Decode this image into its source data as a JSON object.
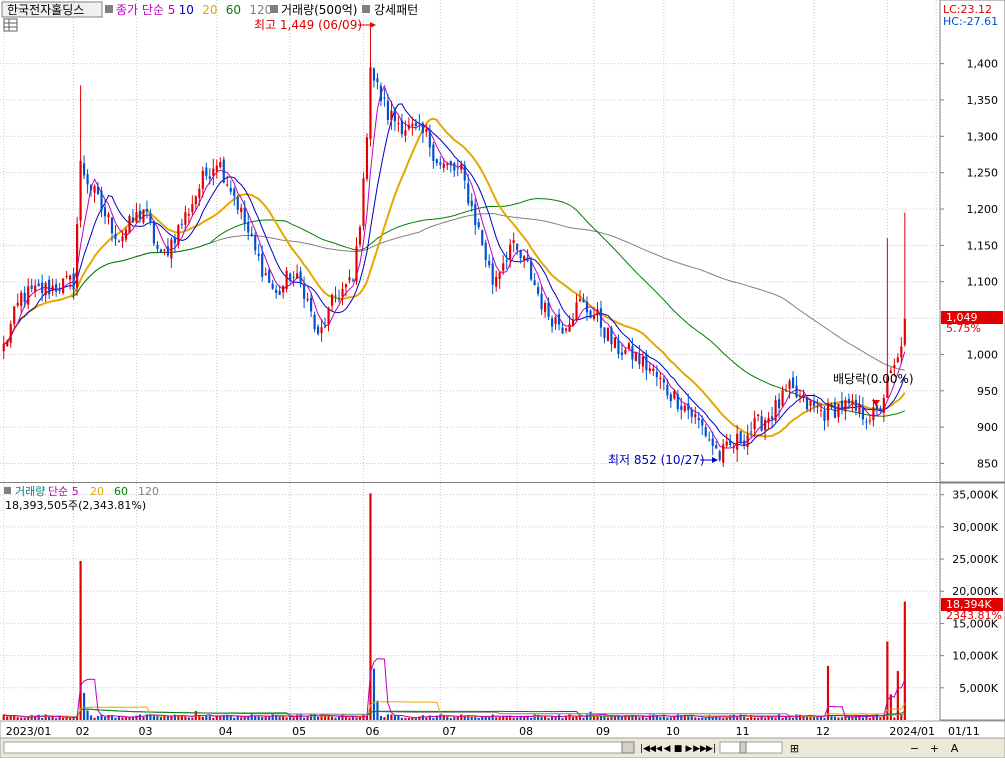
{
  "header": {
    "stock_name": "한국전자홀딩스",
    "price_ma_legend": [
      {
        "label": "종가 단순 5",
        "color": "#c000c0"
      },
      {
        "label": "10",
        "color": "#0000c0"
      },
      {
        "label": "20",
        "color": "#e6a800"
      },
      {
        "label": "60",
        "color": "#008000"
      },
      {
        "label": "120",
        "color": "#808080"
      }
    ],
    "volume_amount_label": "거래량(500억)",
    "pattern_label": "강세패턴",
    "lc_label": "LC:23.12",
    "hc_label": "HC:-27.61"
  },
  "price_panel": {
    "y_ticks": [
      {
        "value": 850,
        "label": "850"
      },
      {
        "value": 900,
        "label": "900"
      },
      {
        "value": 950,
        "label": "950"
      },
      {
        "value": 1000,
        "label": "1,000"
      },
      {
        "value": 1050,
        "label": "1,050"
      },
      {
        "value": 1100,
        "label": "1,100"
      },
      {
        "value": 1150,
        "label": "1,150"
      },
      {
        "value": 1200,
        "label": "1,200"
      },
      {
        "value": 1250,
        "label": "1,250"
      },
      {
        "value": 1300,
        "label": "1,300"
      },
      {
        "value": 1350,
        "label": "1,350"
      },
      {
        "value": 1400,
        "label": "1,400"
      }
    ],
    "current_price_label": "1,049",
    "current_change_label": "5.75%",
    "high_annotation": "최고 1,449 (06/09)",
    "low_annotation": "최저 852 (10/27)",
    "dividend_annotation": "배당락(0.00%)"
  },
  "volume_panel": {
    "legend": [
      {
        "label": "거래량",
        "color": "#008080"
      },
      {
        "label": "단순 5",
        "color": "#c000c0"
      },
      {
        "label": "20",
        "color": "#e6a800"
      },
      {
        "label": "60",
        "color": "#008000"
      },
      {
        "label": "120",
        "color": "#808080"
      }
    ],
    "current_volume_text": "18,393,505주(2,343.81%)",
    "y_ticks": [
      {
        "value": 5000,
        "label": "5,000K"
      },
      {
        "value": 10000,
        "label": "10,000K"
      },
      {
        "value": 15000,
        "label": "15,000K"
      },
      {
        "value": 20000,
        "label": "20,000K"
      },
      {
        "value": 25000,
        "label": "25,000K"
      },
      {
        "value": 30000,
        "label": "30,000K"
      },
      {
        "value": 35000,
        "label": "35,000K"
      }
    ],
    "current_volume_label": "18,394K",
    "current_volume_pct_label": "2343.81%"
  },
  "x_axis": {
    "labels": [
      {
        "text": "2023/01",
        "pos": 0
      },
      {
        "text": "02",
        "pos": 20
      },
      {
        "text": "03",
        "pos": 38
      },
      {
        "text": "04",
        "pos": 61
      },
      {
        "text": "05",
        "pos": 82
      },
      {
        "text": "06",
        "pos": 103
      },
      {
        "text": "07",
        "pos": 125
      },
      {
        "text": "08",
        "pos": 147
      },
      {
        "text": "09",
        "pos": 169
      },
      {
        "text": "10",
        "pos": 189
      },
      {
        "text": "11",
        "pos": 209
      },
      {
        "text": "12",
        "pos": 232
      },
      {
        "text": "2024/01",
        "pos": 253
      },
      {
        "text": "01/11",
        "pos": 267
      }
    ]
  },
  "nav_buttons": [
    {
      "name": "first-button",
      "glyph": "|◀"
    },
    {
      "name": "prev-fast-button",
      "glyph": "◀◀"
    },
    {
      "name": "prev-button",
      "glyph": "◀"
    },
    {
      "name": "stop-button",
      "glyph": "■"
    },
    {
      "name": "next-button",
      "glyph": "▶"
    },
    {
      "name": "next-fast-button",
      "glyph": "▶▶"
    },
    {
      "name": "last-button",
      "glyph": "▶|"
    }
  ],
  "zoom_buttons": [
    {
      "name": "zoom-reset-button",
      "glyph": "⊞"
    },
    {
      "name": "zoom-out-button",
      "glyph": "−"
    },
    {
      "name": "zoom-in-button",
      "glyph": "+"
    },
    {
      "name": "auto-button",
      "glyph": "A"
    }
  ],
  "colors": {
    "up": "#e00000",
    "down": "#0050d0",
    "ma5": "#c000c0",
    "ma10": "#0000c0",
    "ma20": "#e6a800",
    "ma60": "#008000",
    "ma120": "#808080",
    "grid": "#c8c8c8",
    "axis_bg": "#ffffff",
    "current_tag": "#e00000"
  },
  "chart_data": {
    "type": "candlestick",
    "title": "한국전자홀딩스",
    "x_range": [
      "2023/01",
      "2024/01/11"
    ],
    "ylim": [
      830,
      1460
    ],
    "volume_ylim": [
      0,
      36500
    ],
    "volume_unit": "K",
    "grid": true,
    "legend_position": "top-left",
    "high": {
      "value": 1449,
      "date": "06/09"
    },
    "low": {
      "value": 852,
      "date": "10/27"
    },
    "last_close": 1049,
    "last_change_pct": 5.75,
    "last_volume": 18393505,
    "last_volume_k": 18394,
    "volume_spikes": [
      {
        "period": "02",
        "value_k": 24700
      },
      {
        "period": "06",
        "value_k": 35200
      },
      {
        "period": "12",
        "value_k": 8400
      },
      {
        "period": "2024/01",
        "value_k": 12200
      },
      {
        "period": "2024/01",
        "value_k": 18394
      }
    ],
    "price_path": [
      {
        "pos": 0,
        "close": 1010
      },
      {
        "pos": 5,
        "close": 1080
      },
      {
        "pos": 12,
        "close": 1090
      },
      {
        "pos": 20,
        "close": 1100
      },
      {
        "pos": 22,
        "close": 1260
      },
      {
        "pos": 28,
        "close": 1200
      },
      {
        "pos": 33,
        "close": 1160
      },
      {
        "pos": 40,
        "close": 1200
      },
      {
        "pos": 45,
        "close": 1130
      },
      {
        "pos": 52,
        "close": 1190
      },
      {
        "pos": 57,
        "close": 1240
      },
      {
        "pos": 61,
        "close": 1270
      },
      {
        "pos": 66,
        "close": 1220
      },
      {
        "pos": 72,
        "close": 1140
      },
      {
        "pos": 78,
        "close": 1080
      },
      {
        "pos": 82,
        "close": 1110
      },
      {
        "pos": 86,
        "close": 1090
      },
      {
        "pos": 90,
        "close": 1020
      },
      {
        "pos": 95,
        "close": 1080
      },
      {
        "pos": 100,
        "close": 1100
      },
      {
        "pos": 103,
        "close": 1230
      },
      {
        "pos": 105,
        "close": 1390
      },
      {
        "pos": 110,
        "close": 1330
      },
      {
        "pos": 116,
        "close": 1310
      },
      {
        "pos": 121,
        "close": 1300
      },
      {
        "pos": 125,
        "close": 1260
      },
      {
        "pos": 131,
        "close": 1250
      },
      {
        "pos": 136,
        "close": 1170
      },
      {
        "pos": 140,
        "close": 1100
      },
      {
        "pos": 145,
        "close": 1150
      },
      {
        "pos": 150,
        "close": 1120
      },
      {
        "pos": 155,
        "close": 1060
      },
      {
        "pos": 160,
        "close": 1040
      },
      {
        "pos": 165,
        "close": 1070
      },
      {
        "pos": 170,
        "close": 1050
      },
      {
        "pos": 175,
        "close": 1010
      },
      {
        "pos": 180,
        "close": 1000
      },
      {
        "pos": 185,
        "close": 980
      },
      {
        "pos": 190,
        "close": 950
      },
      {
        "pos": 195,
        "close": 930
      },
      {
        "pos": 200,
        "close": 900
      },
      {
        "pos": 205,
        "close": 860
      },
      {
        "pos": 210,
        "close": 880
      },
      {
        "pos": 215,
        "close": 900
      },
      {
        "pos": 220,
        "close": 920
      },
      {
        "pos": 225,
        "close": 950
      },
      {
        "pos": 230,
        "close": 930
      },
      {
        "pos": 235,
        "close": 920
      },
      {
        "pos": 240,
        "close": 930
      },
      {
        "pos": 245,
        "close": 920
      },
      {
        "pos": 250,
        "close": 915
      },
      {
        "pos": 253,
        "close": 960
      },
      {
        "pos": 256,
        "close": 990
      },
      {
        "pos": 258,
        "close": 1049
      }
    ]
  }
}
